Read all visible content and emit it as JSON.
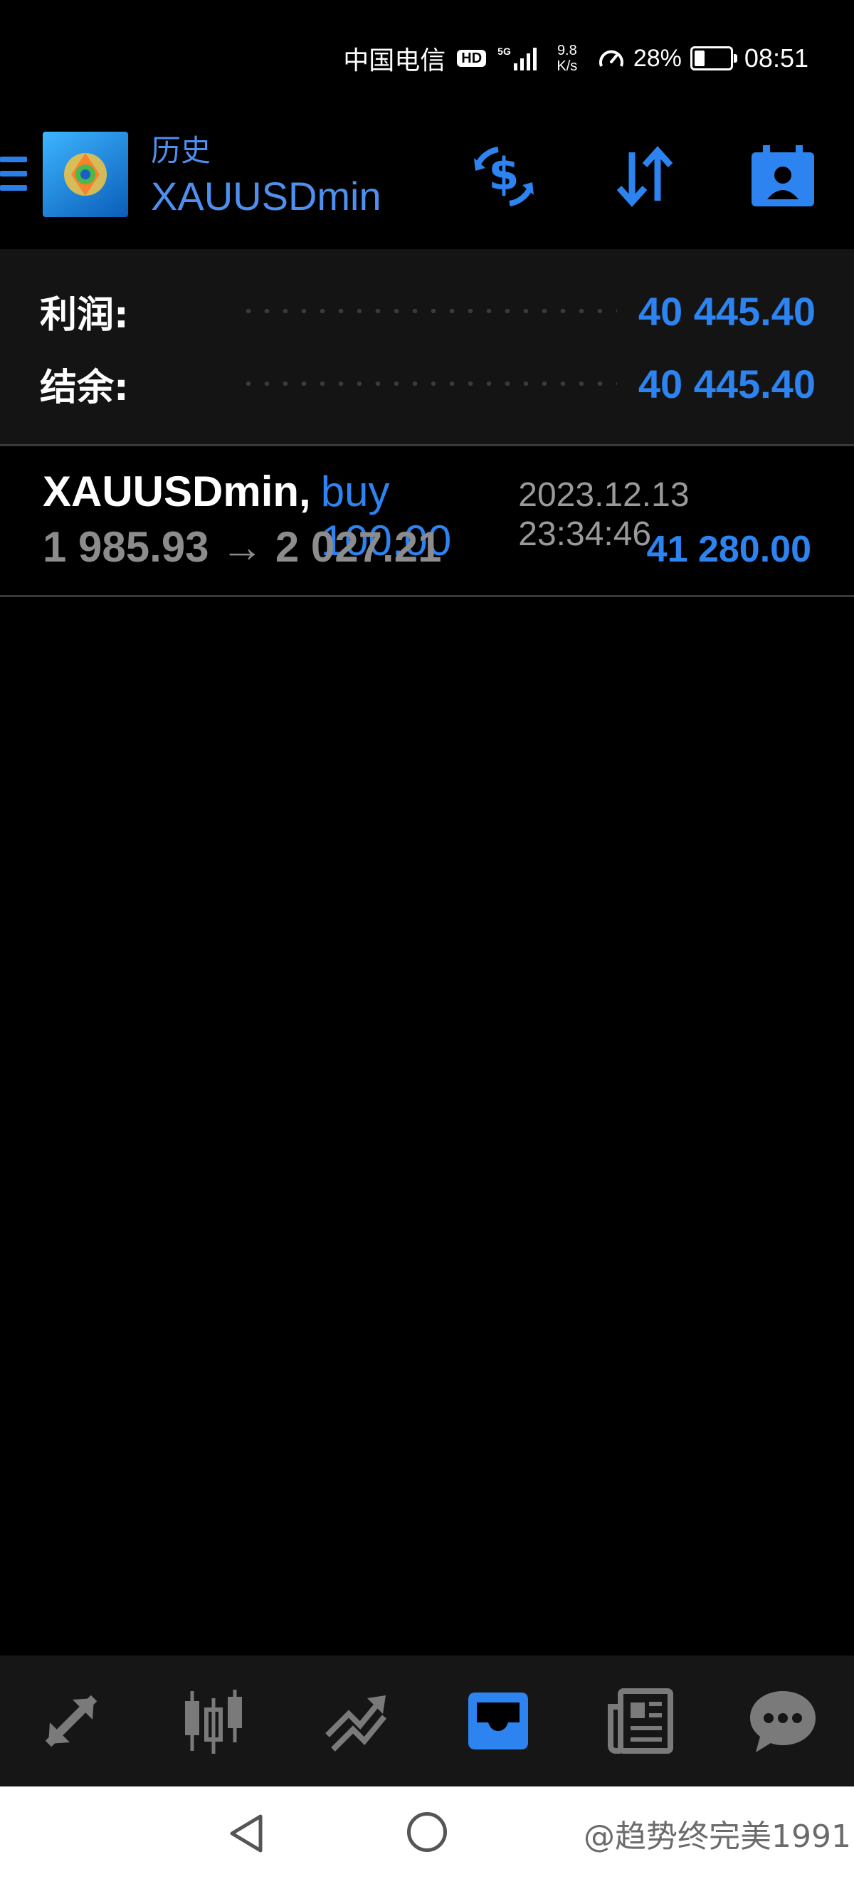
{
  "status_bar": {
    "carrier": "中国电信",
    "hd": "HD",
    "network": "5G",
    "net_speed_value": "9.8",
    "net_speed_unit": "K/s",
    "battery_percent": "28%",
    "time": "08:51"
  },
  "app_bar": {
    "section": "历史",
    "symbol": "XAUUSDmin",
    "icons": [
      "menu-icon",
      "app-logo",
      "currency-exchange-icon",
      "sort-icon",
      "calendar-contact-icon"
    ]
  },
  "summary": {
    "profit_label": "利润:",
    "profit_value": "40 445.40",
    "balance_label": "结余:",
    "balance_value": "40 445.40"
  },
  "trade": {
    "symbol": "XAUUSDmin,",
    "type": "buy 100.00",
    "time": "2023.12.13 23:34:46",
    "prices": "1 985.93 → 2 027.21",
    "profit": "41 280.00"
  },
  "bottom_nav": {
    "items": [
      {
        "icon": "quotes-icon",
        "active": false
      },
      {
        "icon": "chart-candles-icon",
        "active": false
      },
      {
        "icon": "trade-icon",
        "active": false
      },
      {
        "icon": "history-inbox-icon",
        "active": true
      },
      {
        "icon": "news-icon",
        "active": false
      },
      {
        "icon": "messages-icon",
        "active": false
      }
    ]
  },
  "watermark": "@趋势终完美1991",
  "colors": {
    "accent": "#2d84f0",
    "inactive_icon": "#7a7a7a",
    "background": "#000000"
  }
}
